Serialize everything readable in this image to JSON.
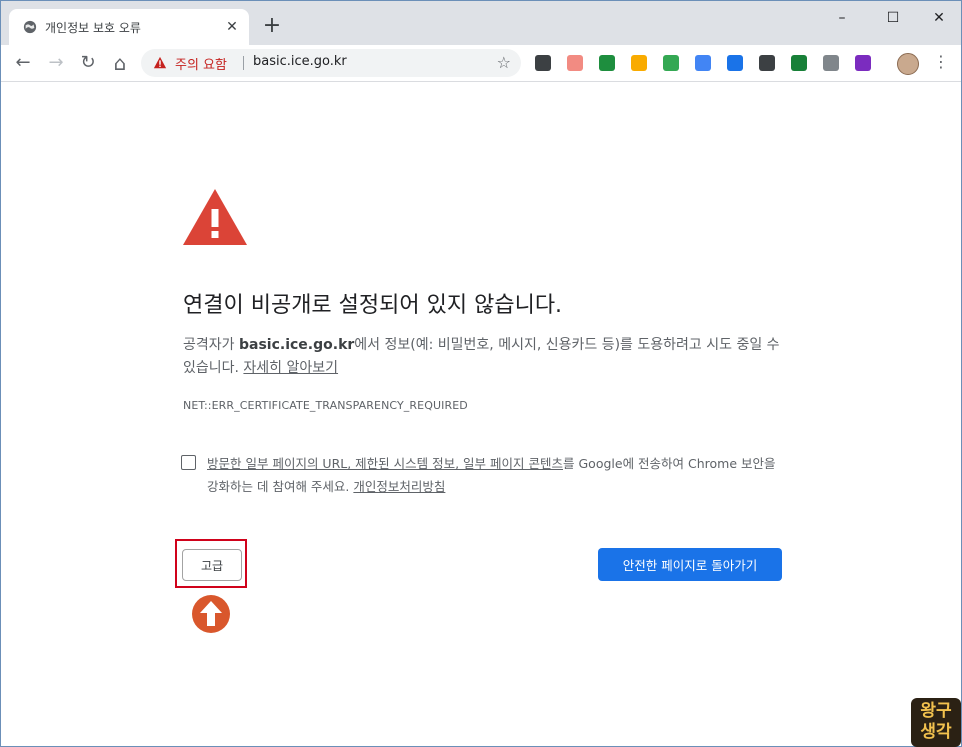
{
  "window": {
    "tab_title": "개인정보 보호 오류",
    "new_tab_symbol": "+",
    "tab_close_symbol": "✕",
    "minimize_symbol": "–",
    "maximize_symbol": "☐",
    "close_symbol": "✕"
  },
  "toolbar": {
    "back_symbol": "←",
    "forward_symbol": "→",
    "reload_symbol": "↻",
    "home_symbol": "⌂",
    "security_warning": "주의 요함",
    "url": "basic.ice.go.kr",
    "bookmark_symbol": "☆",
    "menu_symbol": "⋮",
    "extensions": [
      {
        "name": "download-icon",
        "color": "#3c4043"
      },
      {
        "name": "media-icon",
        "color": "#f28b82"
      },
      {
        "name": "classroom-icon",
        "color": "#1e8e3e"
      },
      {
        "name": "clock-icon",
        "color": "#f9ab00"
      },
      {
        "name": "drive-icon",
        "color": "#34a853"
      },
      {
        "name": "translate-icon",
        "color": "#4285f4"
      },
      {
        "name": "megaphone-icon",
        "color": "#1a73e8"
      },
      {
        "name": "keep-icon",
        "color": "#3c4043"
      },
      {
        "name": "cast-icon",
        "color": "#188038"
      },
      {
        "name": "drive-gray-icon",
        "color": "#80868b"
      },
      {
        "name": "visual-studio-icon",
        "color": "#7b2cbf"
      }
    ]
  },
  "content": {
    "heading": "연결이 비공개로 설정되어 있지 않습니다.",
    "para_part1": "공격자가 ",
    "domain": "basic.ice.go.kr",
    "para_part2": "에서 정보(예: 비밀번호, 메시지, 신용카드 등)를 도용하려고 시도 중일 수 있습니다. ",
    "learn_more": "자세히 알아보기",
    "error_code": "NET::ERR_CERTIFICATE_TRANSPARENCY_REQUIRED",
    "consent_link1": "방문한 일부 페이지의 URL, 제한된 시스템 정보, 일부 페이지 콘텐츠",
    "consent_text1": "를 Google에 전송하여 Chrome 보안을 강화하는 데 참여해 주세요. ",
    "consent_link2": "개인정보처리방침",
    "advanced_button": "고급",
    "back_to_safety_button": "안전한 페이지로 돌아가기"
  },
  "watermark": {
    "line1": "왕구",
    "line2": "생각"
  },
  "colors": {
    "warning_red": "#db4437",
    "primary_blue": "#1a73e8",
    "highlight_red": "#d0021b",
    "arrow_orange": "#d9572c"
  }
}
